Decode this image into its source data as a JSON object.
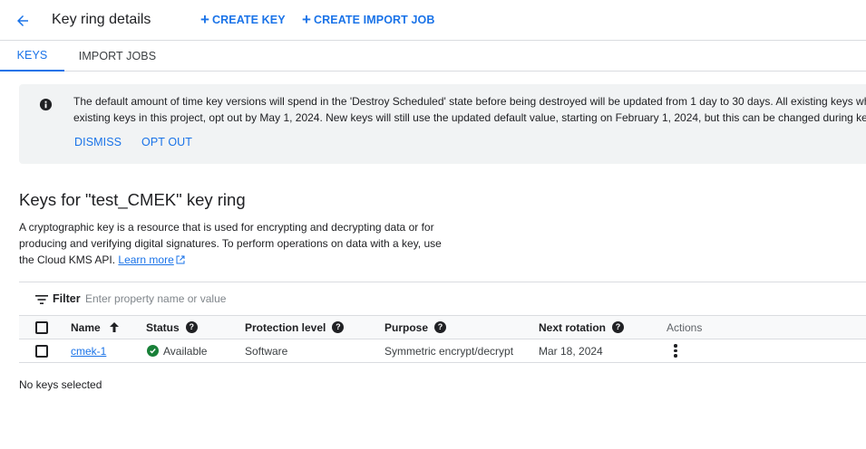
{
  "header": {
    "title": "Key ring details",
    "create_key": "CREATE KEY",
    "create_import_job": "CREATE IMPORT JOB",
    "back_icon": "arrow-back-icon"
  },
  "tabs": [
    {
      "label": "KEYS",
      "active": true
    },
    {
      "label": "IMPORT JOBS",
      "active": false
    }
  ],
  "banner": {
    "icon": "info-icon",
    "line1": "The default amount of time key versions will spend in the 'Destroy Scheduled' state before being destroyed will be updated from 1 day to 30 days. All existing keys which use the previous default will be updated. To keep the previous default for",
    "line2": "existing keys in this project, opt out by May 1, 2024. New keys will still use the updated default value, starting on February 1, 2024, but this can be changed during key creation.",
    "dismiss": "DISMISS",
    "opt_out": "OPT OUT"
  },
  "section": {
    "title": "Keys for \"test_CMEK\" key ring",
    "description": "A cryptographic key is a resource that is used for encrypting and decrypting data or for producing and verifying digital signatures. To perform operations on data with a key, use the Cloud KMS API.",
    "learn_more": "Learn more"
  },
  "filter": {
    "label": "Filter",
    "placeholder": "Enter property name or value"
  },
  "table": {
    "columns": {
      "name": "Name",
      "status": "Status",
      "protection_level": "Protection level",
      "purpose": "Purpose",
      "next_rotation": "Next rotation",
      "actions": "Actions"
    },
    "rows": [
      {
        "name": "cmek-1",
        "status": "Available",
        "protection_level": "Software",
        "purpose": "Symmetric encrypt/decrypt",
        "next_rotation": "Mar 18, 2024"
      }
    ]
  },
  "selection_status": "No keys selected",
  "colors": {
    "accent": "#1a73e8",
    "success": "#188038",
    "banner_bg": "#f1f3f4"
  }
}
